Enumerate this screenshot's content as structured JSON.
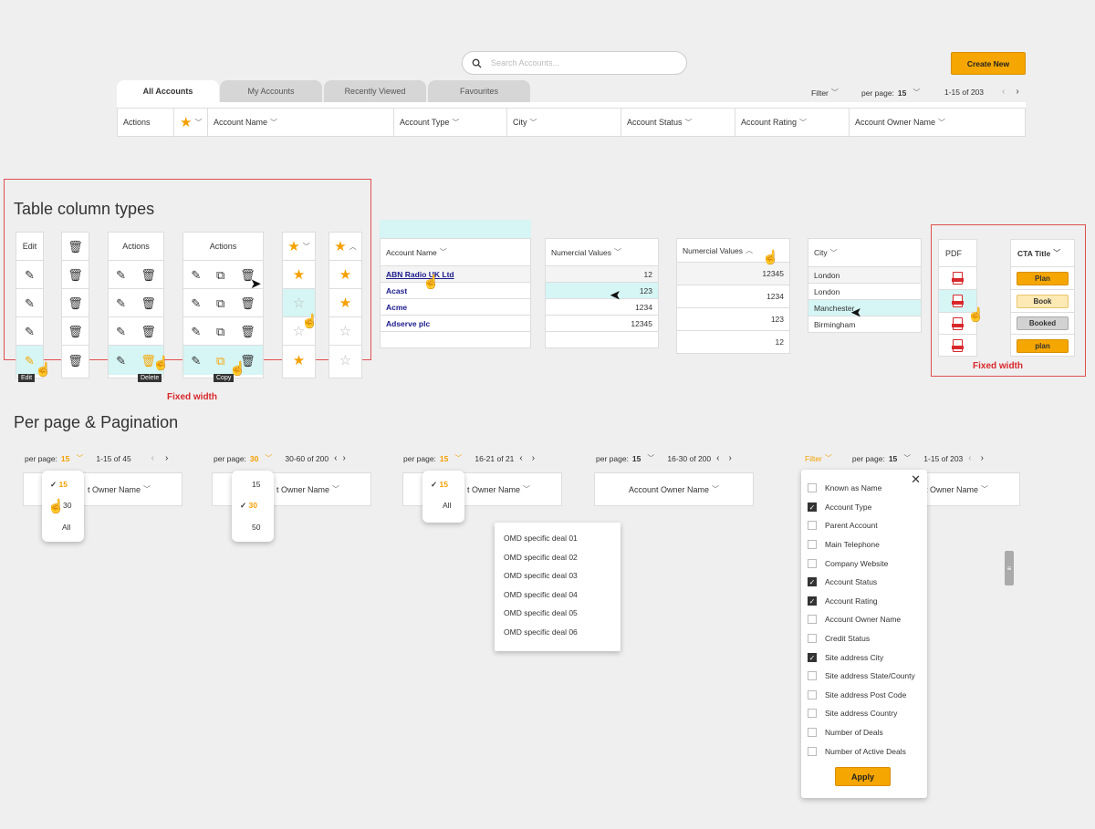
{
  "search": {
    "placeholder": "Search Accounts..."
  },
  "create_button": "Create New",
  "tabs": [
    "All Accounts",
    "My Accounts",
    "Recently Viewed",
    "Favourites"
  ],
  "toolbar": {
    "filter": "Filter",
    "per_page_label": "per page:",
    "per_page_value": "15",
    "range": "1-15 of 203"
  },
  "columns": [
    "Actions",
    "Account Name",
    "Account Type",
    "City",
    "Account Status",
    "Account Rating",
    "Account Owner Name"
  ],
  "section1": {
    "title": "Table column types",
    "fixed_width": "Fixed width",
    "fixed_width2": "Fixed width"
  },
  "col_edit": {
    "header": "Edit",
    "tooltip": "Edit"
  },
  "col_actions2": {
    "header": "Actions",
    "tooltip": "Delete"
  },
  "col_actions3": {
    "header": "Actions",
    "tooltip": "Copy"
  },
  "accounts": {
    "header": "Account Name",
    "rows": [
      "ABN Radio UK Ltd",
      "Acast",
      "Acme",
      "Adserve plc"
    ]
  },
  "numeric1": {
    "header": "Numercial Values",
    "rows": [
      "12",
      "123",
      "1234",
      "12345"
    ]
  },
  "numeric2": {
    "header": "Numercial Values",
    "rows": [
      "12345",
      "1234",
      "123",
      "12"
    ]
  },
  "city": {
    "header": "City",
    "rows": [
      "London",
      "London",
      "Manchester",
      "Birmingham"
    ]
  },
  "pdf": {
    "header": "PDF"
  },
  "cta": {
    "header": "CTA Title",
    "buttons": [
      "Plan",
      "Book",
      "Booked",
      "plan"
    ]
  },
  "section2": {
    "title": "Per page & Pagination"
  },
  "pager1": {
    "label": "per page:",
    "value": "15",
    "range": "1-15 of 45",
    "options": [
      "15",
      "30",
      "All"
    ]
  },
  "pager2": {
    "label": "per page:",
    "value": "30",
    "range": "30-60 of 200",
    "options": [
      "15",
      "30",
      "50"
    ]
  },
  "pager3": {
    "label": "per page:",
    "value": "15",
    "range": "16-21 of 21",
    "options": [
      "15",
      "All"
    ]
  },
  "pager4": {
    "label": "per page:",
    "value": "15",
    "range": "16-30 of 200"
  },
  "pager5": {
    "filter": "Filter",
    "label": "per page:",
    "value": "15",
    "range": "1-15 of 203"
  },
  "owner_col": "Account Owner Name",
  "owner_col_partial": "t Owner Name",
  "deals": [
    "OMD specific deal 01",
    "OMD specific deal 02",
    "OMD specific deal 03",
    "OMD specific deal 04",
    "OMD specific deal 05",
    "OMD specific deal 06"
  ],
  "filter_items": [
    {
      "label": "Known as Name",
      "checked": false
    },
    {
      "label": "Account Type",
      "checked": true
    },
    {
      "label": "Parent Account",
      "checked": false
    },
    {
      "label": "Main Telephone",
      "checked": false
    },
    {
      "label": "Company Website",
      "checked": false
    },
    {
      "label": "Account Status",
      "checked": true
    },
    {
      "label": "Account Rating",
      "checked": true
    },
    {
      "label": "Account Owner Name",
      "checked": false
    },
    {
      "label": "Credit Status",
      "checked": false
    },
    {
      "label": "Site address City",
      "checked": true
    },
    {
      "label": "Site address State/County",
      "checked": false
    },
    {
      "label": "Site address Post Code",
      "checked": false
    },
    {
      "label": "Site address Country",
      "checked": false
    },
    {
      "label": "Number of Deals",
      "checked": false
    },
    {
      "label": "Number of Active Deals",
      "checked": false
    }
  ],
  "apply": "Apply",
  "colors": {
    "accent": "#f5a600",
    "highlight": "#d6f5f5",
    "danger": "#d8282c"
  }
}
